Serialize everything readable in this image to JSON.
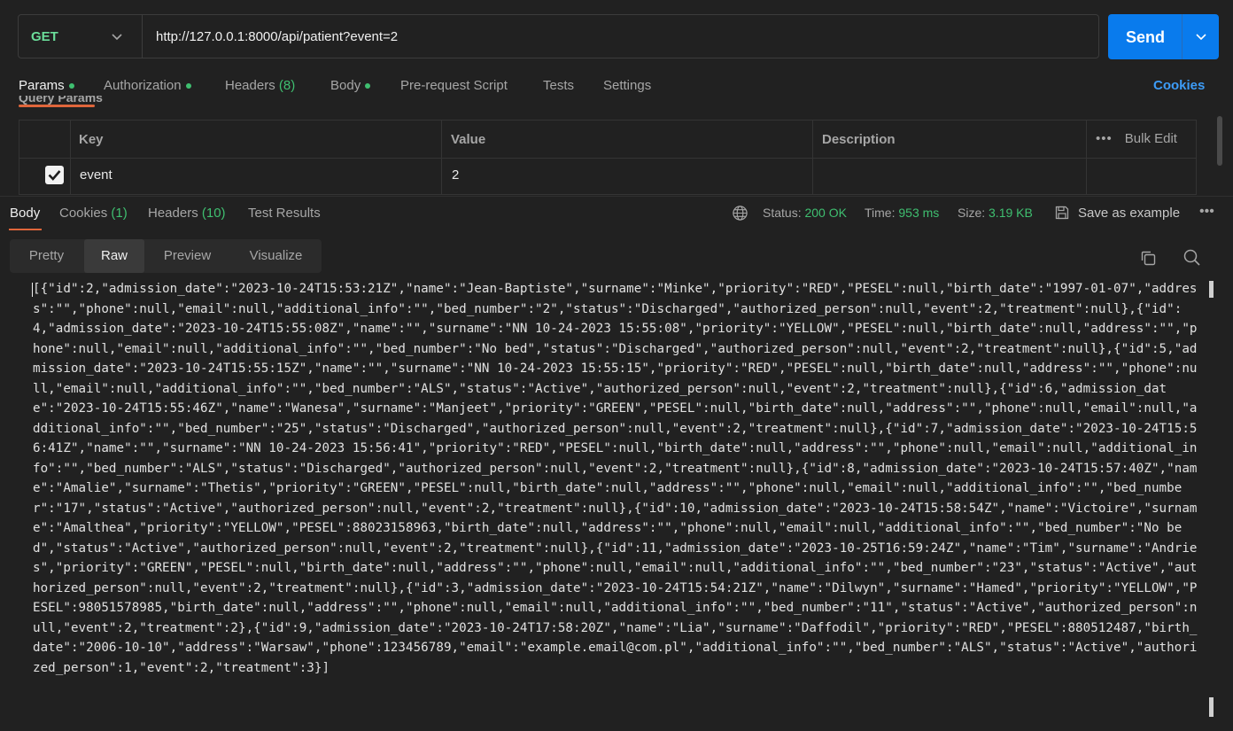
{
  "request": {
    "method": "GET",
    "url": "http://127.0.0.1:8000/api/patient?event=2",
    "send_label": "Send"
  },
  "request_tabs": [
    {
      "label": "Params",
      "dot": true
    },
    {
      "label": "Authorization",
      "dot": true
    },
    {
      "label": "Headers",
      "count": "(8)"
    },
    {
      "label": "Body",
      "dot": true
    },
    {
      "label": "Pre-request Script"
    },
    {
      "label": "Tests"
    },
    {
      "label": "Settings"
    }
  ],
  "cookies_link": "Cookies",
  "query_params": {
    "section_label": "Query Params",
    "headers": {
      "key": "Key",
      "value": "Value",
      "description": "Description",
      "bulk_edit": "Bulk Edit"
    },
    "rows": [
      {
        "checked": true,
        "key": "event",
        "value": "2",
        "description": ""
      }
    ]
  },
  "response_tabs": [
    {
      "label": "Body"
    },
    {
      "label": "Cookies",
      "count": "(1)"
    },
    {
      "label": "Headers",
      "count": "(10)"
    },
    {
      "label": "Test Results"
    }
  ],
  "response_meta": {
    "status_label": "Status:",
    "status_value": "200 OK",
    "time_label": "Time:",
    "time_value": "953 ms",
    "size_label": "Size:",
    "size_value": "3.19 KB",
    "save_label": "Save as example"
  },
  "view_modes": [
    "Pretty",
    "Raw",
    "Preview",
    "Visualize"
  ],
  "active_view": "Raw",
  "response_body": "[{\"id\":2,\"admission_date\":\"2023-10-24T15:53:21Z\",\"name\":\"Jean-Baptiste\",\"surname\":\"Minke\",\"priority\":\"RED\",\"PESEL\":null,\"birth_date\":\"1997-01-07\",\"address\":\"\",\"phone\":null,\"email\":null,\"additional_info\":\"\",\"bed_number\":\"2\",\"status\":\"Discharged\",\"authorized_person\":null,\"event\":2,\"treatment\":null},{\"id\":4,\"admission_date\":\"2023-10-24T15:55:08Z\",\"name\":\"\",\"surname\":\"NN 10-24-2023 15:55:08\",\"priority\":\"YELLOW\",\"PESEL\":null,\"birth_date\":null,\"address\":\"\",\"phone\":null,\"email\":null,\"additional_info\":\"\",\"bed_number\":\"No bed\",\"status\":\"Discharged\",\"authorized_person\":null,\"event\":2,\"treatment\":null},{\"id\":5,\"admission_date\":\"2023-10-24T15:55:15Z\",\"name\":\"\",\"surname\":\"NN 10-24-2023 15:55:15\",\"priority\":\"RED\",\"PESEL\":null,\"birth_date\":null,\"address\":\"\",\"phone\":null,\"email\":null,\"additional_info\":\"\",\"bed_number\":\"ALS\",\"status\":\"Active\",\"authorized_person\":null,\"event\":2,\"treatment\":null},{\"id\":6,\"admission_date\":\"2023-10-24T15:55:46Z\",\"name\":\"Wanesa\",\"surname\":\"Manjeet\",\"priority\":\"GREEN\",\"PESEL\":null,\"birth_date\":null,\"address\":\"\",\"phone\":null,\"email\":null,\"additional_info\":\"\",\"bed_number\":\"25\",\"status\":\"Discharged\",\"authorized_person\":null,\"event\":2,\"treatment\":null},{\"id\":7,\"admission_date\":\"2023-10-24T15:56:41Z\",\"name\":\"\",\"surname\":\"NN 10-24-2023 15:56:41\",\"priority\":\"RED\",\"PESEL\":null,\"birth_date\":null,\"address\":\"\",\"phone\":null,\"email\":null,\"additional_info\":\"\",\"bed_number\":\"ALS\",\"status\":\"Discharged\",\"authorized_person\":null,\"event\":2,\"treatment\":null},{\"id\":8,\"admission_date\":\"2023-10-24T15:57:40Z\",\"name\":\"Amalie\",\"surname\":\"Thetis\",\"priority\":\"GREEN\",\"PESEL\":null,\"birth_date\":null,\"address\":\"\",\"phone\":null,\"email\":null,\"additional_info\":\"\",\"bed_number\":\"17\",\"status\":\"Active\",\"authorized_person\":null,\"event\":2,\"treatment\":null},{\"id\":10,\"admission_date\":\"2023-10-24T15:58:54Z\",\"name\":\"Victoire\",\"surname\":\"Amalthea\",\"priority\":\"YELLOW\",\"PESEL\":88023158963,\"birth_date\":null,\"address\":\"\",\"phone\":null,\"email\":null,\"additional_info\":\"\",\"bed_number\":\"No bed\",\"status\":\"Active\",\"authorized_person\":null,\"event\":2,\"treatment\":null},{\"id\":11,\"admission_date\":\"2023-10-25T16:59:24Z\",\"name\":\"Tim\",\"surname\":\"Andries\",\"priority\":\"GREEN\",\"PESEL\":null,\"birth_date\":null,\"address\":\"\",\"phone\":null,\"email\":null,\"additional_info\":\"\",\"bed_number\":\"23\",\"status\":\"Active\",\"authorized_person\":null,\"event\":2,\"treatment\":null},{\"id\":3,\"admission_date\":\"2023-10-24T15:54:21Z\",\"name\":\"Dilwyn\",\"surname\":\"Hamed\",\"priority\":\"YELLOW\",\"PESEL\":98051578985,\"birth_date\":null,\"address\":\"\",\"phone\":null,\"email\":null,\"additional_info\":\"\",\"bed_number\":\"11\",\"status\":\"Active\",\"authorized_person\":null,\"event\":2,\"treatment\":2},{\"id\":9,\"admission_date\":\"2023-10-24T17:58:20Z\",\"name\":\"Lia\",\"surname\":\"Daffodil\",\"priority\":\"RED\",\"PESEL\":880512487,\"birth_date\":\"2006-10-10\",\"address\":\"Warsaw\",\"phone\":123456789,\"email\":\"example.email@com.pl\",\"additional_info\":\"\",\"bed_number\":\"ALS\",\"status\":\"Active\",\"authorized_person\":1,\"event\":2,\"treatment\":3}]",
  "icons": {
    "method_caret": "chevron-down-icon",
    "send_caret": "chevron-down-icon",
    "globe": "globe-icon",
    "save": "save-icon",
    "copy": "copy-icon",
    "search": "search-icon",
    "more": "more-icon"
  },
  "colors": {
    "accent": "#097bed",
    "method": "#6bdd9a",
    "success": "#3fbf70",
    "tab_underline": "#e0663b",
    "link": "#3d9cf7"
  }
}
